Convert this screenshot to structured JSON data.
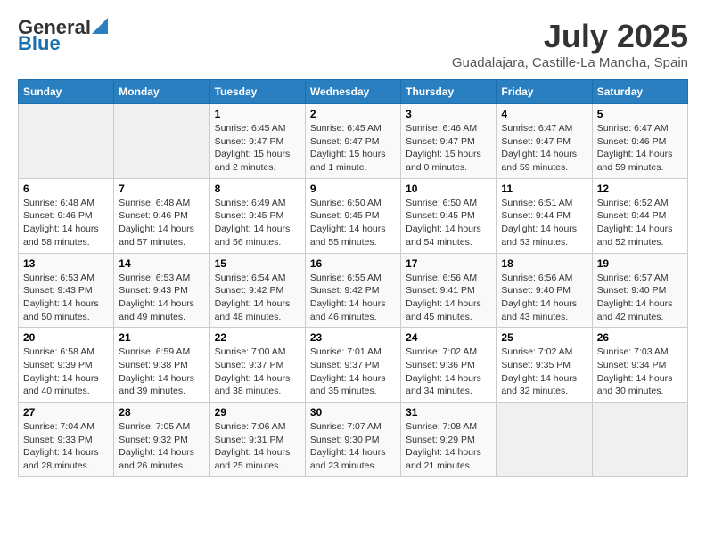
{
  "header": {
    "logo_general": "General",
    "logo_blue": "Blue",
    "month_title": "July 2025",
    "location": "Guadalajara, Castille-La Mancha, Spain"
  },
  "weekdays": [
    "Sunday",
    "Monday",
    "Tuesday",
    "Wednesday",
    "Thursday",
    "Friday",
    "Saturday"
  ],
  "weeks": [
    [
      {
        "day": "",
        "info": ""
      },
      {
        "day": "",
        "info": ""
      },
      {
        "day": "1",
        "info": "Sunrise: 6:45 AM\nSunset: 9:47 PM\nDaylight: 15 hours and 2 minutes."
      },
      {
        "day": "2",
        "info": "Sunrise: 6:45 AM\nSunset: 9:47 PM\nDaylight: 15 hours and 1 minute."
      },
      {
        "day": "3",
        "info": "Sunrise: 6:46 AM\nSunset: 9:47 PM\nDaylight: 15 hours and 0 minutes."
      },
      {
        "day": "4",
        "info": "Sunrise: 6:47 AM\nSunset: 9:47 PM\nDaylight: 14 hours and 59 minutes."
      },
      {
        "day": "5",
        "info": "Sunrise: 6:47 AM\nSunset: 9:46 PM\nDaylight: 14 hours and 59 minutes."
      }
    ],
    [
      {
        "day": "6",
        "info": "Sunrise: 6:48 AM\nSunset: 9:46 PM\nDaylight: 14 hours and 58 minutes."
      },
      {
        "day": "7",
        "info": "Sunrise: 6:48 AM\nSunset: 9:46 PM\nDaylight: 14 hours and 57 minutes."
      },
      {
        "day": "8",
        "info": "Sunrise: 6:49 AM\nSunset: 9:45 PM\nDaylight: 14 hours and 56 minutes."
      },
      {
        "day": "9",
        "info": "Sunrise: 6:50 AM\nSunset: 9:45 PM\nDaylight: 14 hours and 55 minutes."
      },
      {
        "day": "10",
        "info": "Sunrise: 6:50 AM\nSunset: 9:45 PM\nDaylight: 14 hours and 54 minutes."
      },
      {
        "day": "11",
        "info": "Sunrise: 6:51 AM\nSunset: 9:44 PM\nDaylight: 14 hours and 53 minutes."
      },
      {
        "day": "12",
        "info": "Sunrise: 6:52 AM\nSunset: 9:44 PM\nDaylight: 14 hours and 52 minutes."
      }
    ],
    [
      {
        "day": "13",
        "info": "Sunrise: 6:53 AM\nSunset: 9:43 PM\nDaylight: 14 hours and 50 minutes."
      },
      {
        "day": "14",
        "info": "Sunrise: 6:53 AM\nSunset: 9:43 PM\nDaylight: 14 hours and 49 minutes."
      },
      {
        "day": "15",
        "info": "Sunrise: 6:54 AM\nSunset: 9:42 PM\nDaylight: 14 hours and 48 minutes."
      },
      {
        "day": "16",
        "info": "Sunrise: 6:55 AM\nSunset: 9:42 PM\nDaylight: 14 hours and 46 minutes."
      },
      {
        "day": "17",
        "info": "Sunrise: 6:56 AM\nSunset: 9:41 PM\nDaylight: 14 hours and 45 minutes."
      },
      {
        "day": "18",
        "info": "Sunrise: 6:56 AM\nSunset: 9:40 PM\nDaylight: 14 hours and 43 minutes."
      },
      {
        "day": "19",
        "info": "Sunrise: 6:57 AM\nSunset: 9:40 PM\nDaylight: 14 hours and 42 minutes."
      }
    ],
    [
      {
        "day": "20",
        "info": "Sunrise: 6:58 AM\nSunset: 9:39 PM\nDaylight: 14 hours and 40 minutes."
      },
      {
        "day": "21",
        "info": "Sunrise: 6:59 AM\nSunset: 9:38 PM\nDaylight: 14 hours and 39 minutes."
      },
      {
        "day": "22",
        "info": "Sunrise: 7:00 AM\nSunset: 9:37 PM\nDaylight: 14 hours and 38 minutes."
      },
      {
        "day": "23",
        "info": "Sunrise: 7:01 AM\nSunset: 9:37 PM\nDaylight: 14 hours and 35 minutes."
      },
      {
        "day": "24",
        "info": "Sunrise: 7:02 AM\nSunset: 9:36 PM\nDaylight: 14 hours and 34 minutes."
      },
      {
        "day": "25",
        "info": "Sunrise: 7:02 AM\nSunset: 9:35 PM\nDaylight: 14 hours and 32 minutes."
      },
      {
        "day": "26",
        "info": "Sunrise: 7:03 AM\nSunset: 9:34 PM\nDaylight: 14 hours and 30 minutes."
      }
    ],
    [
      {
        "day": "27",
        "info": "Sunrise: 7:04 AM\nSunset: 9:33 PM\nDaylight: 14 hours and 28 minutes."
      },
      {
        "day": "28",
        "info": "Sunrise: 7:05 AM\nSunset: 9:32 PM\nDaylight: 14 hours and 26 minutes."
      },
      {
        "day": "29",
        "info": "Sunrise: 7:06 AM\nSunset: 9:31 PM\nDaylight: 14 hours and 25 minutes."
      },
      {
        "day": "30",
        "info": "Sunrise: 7:07 AM\nSunset: 9:30 PM\nDaylight: 14 hours and 23 minutes."
      },
      {
        "day": "31",
        "info": "Sunrise: 7:08 AM\nSunset: 9:29 PM\nDaylight: 14 hours and 21 minutes."
      },
      {
        "day": "",
        "info": ""
      },
      {
        "day": "",
        "info": ""
      }
    ]
  ]
}
